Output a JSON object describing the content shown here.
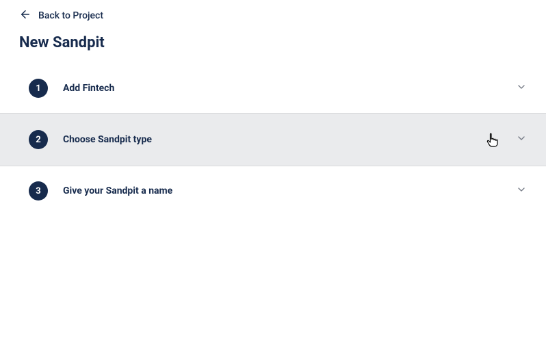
{
  "back": {
    "label": "Back to Project"
  },
  "title": "New Sandpit",
  "steps": [
    {
      "number": "1",
      "label": "Add Fintech"
    },
    {
      "number": "2",
      "label": "Choose Sandpit type"
    },
    {
      "number": "3",
      "label": "Give your Sandpit a name"
    }
  ]
}
